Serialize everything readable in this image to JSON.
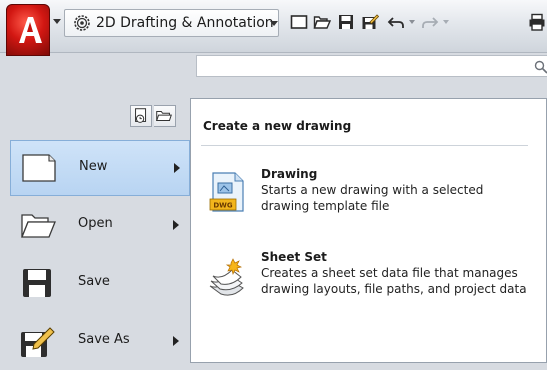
{
  "workspace": {
    "name": "2D Drafting & Annotation"
  },
  "search": {
    "placeholder": ""
  },
  "commands": {
    "new": "New",
    "open": "Open",
    "save": "Save",
    "save_as": "Save As"
  },
  "panel": {
    "title": "Create a new drawing",
    "drawing": {
      "name": "Drawing",
      "description": "Starts a new drawing with a selected drawing template file",
      "badge": "DWG"
    },
    "sheet_set": {
      "name": "Sheet Set",
      "description": "Creates a sheet set data file that manages drawing layouts, file paths, and project data"
    }
  },
  "icons": {
    "app": "autocad-a-logo-icon",
    "workspace": "gear-icon",
    "qat": [
      "new-file-icon",
      "open-folder-icon",
      "save-icon",
      "save-as-icon",
      "undo-icon",
      "redo-icon",
      "plot-icon"
    ]
  },
  "colors": {
    "accent": "#d21712",
    "selected": "#c6dcf6"
  }
}
